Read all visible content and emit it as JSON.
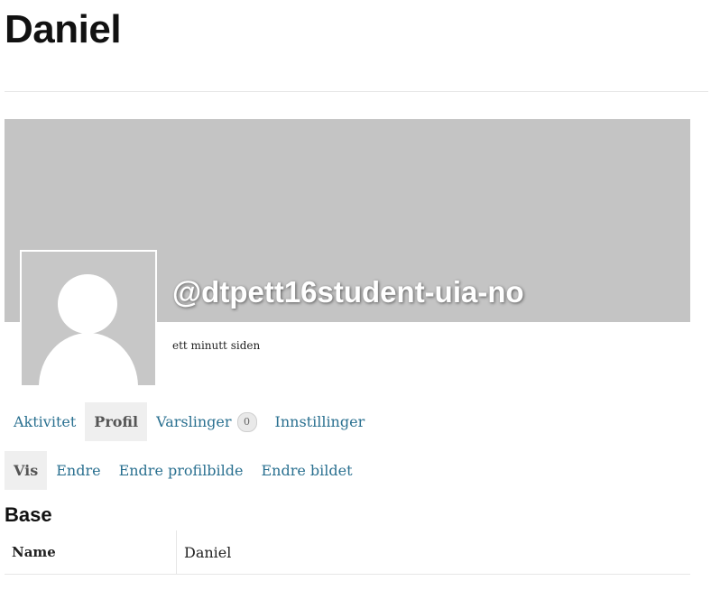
{
  "page": {
    "title": "Daniel"
  },
  "profile": {
    "username": "@dtpett16student-uia-no",
    "last_active": "ett minutt siden"
  },
  "tabs": [
    {
      "label": "Aktivitet",
      "active": false
    },
    {
      "label": "Profil",
      "active": true
    },
    {
      "label": "Varslinger",
      "badge": "0",
      "active": false
    },
    {
      "label": "Innstillinger",
      "active": false
    }
  ],
  "subtabs": [
    {
      "label": "Vis",
      "active": true
    },
    {
      "label": "Endre",
      "active": false
    },
    {
      "label": "Endre profilbilde",
      "active": false
    },
    {
      "label": "Endre bildet",
      "active": false
    }
  ],
  "section": {
    "title": "Base",
    "fields": [
      {
        "label": "Name",
        "value": "Daniel"
      }
    ]
  },
  "colors": {
    "link": "#2a7090",
    "cover": "#c4c4c4",
    "active_tab_bg": "#efefef"
  }
}
